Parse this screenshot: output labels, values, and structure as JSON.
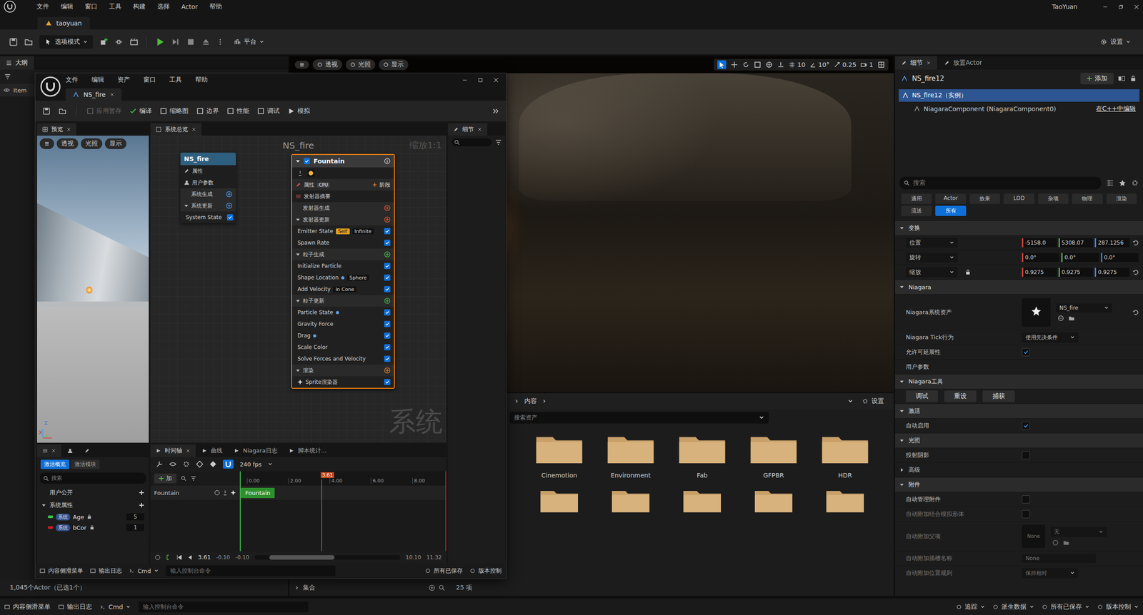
{
  "menubar": {
    "items": [
      "文件",
      "编辑",
      "窗口",
      "工具",
      "构建",
      "选择",
      "Actor",
      "帮助"
    ],
    "user": "TaoYuan"
  },
  "level_tab": {
    "label": "taoyuan"
  },
  "toolbar": {
    "mode": "选项模式",
    "platform": "平台",
    "settings": "设置"
  },
  "outliner": {
    "tab": "大纲",
    "column": "Item",
    "footer": "1,045个Actor（已选1个）"
  },
  "viewport": {
    "view_buttons": [
      "透视",
      "光照",
      "显示"
    ],
    "grid_snap": "10",
    "angle_snap": "10°",
    "scale_snap": "0.25",
    "camera_speed": "1"
  },
  "content_browser": {
    "path": "内容",
    "settings": "设置",
    "search": "搜索资产",
    "folders": [
      "Cinemotion",
      "Environment",
      "Fab",
      "GFPBR",
      "HDR"
    ],
    "collections": "集合",
    "count": "25 项"
  },
  "details": {
    "tabs": [
      {
        "label": "细节",
        "selected": true
      },
      {
        "label": "放置Actor",
        "selected": false
      }
    ],
    "actor": "NS_fire12",
    "add": "添加",
    "tree": [
      {
        "label": "NS_fire12（实例）",
        "selected": true,
        "link": ""
      },
      {
        "label": "NiagaraComponent (NiagaraComponent0)",
        "selected": false,
        "link": "在C++中编辑"
      }
    ],
    "search": "搜索",
    "filters": [
      {
        "label": "通用",
        "selected": false
      },
      {
        "label": "Actor",
        "selected": false
      },
      {
        "label": "效果",
        "selected": false
      },
      {
        "label": "LOD",
        "selected": false
      },
      {
        "label": "杂项",
        "selected": false
      },
      {
        "label": "物理",
        "selected": false
      },
      {
        "label": "渲染",
        "selected": false
      },
      {
        "label": "流送",
        "selected": false
      },
      {
        "label": "所有",
        "selected": true
      }
    ],
    "rows": [
      {
        "kind": "section",
        "label": "变换",
        "expanded": true,
        "disabled": false
      },
      {
        "kind": "vector",
        "label": "位置",
        "values": [
          "-5158.0",
          "5308.07",
          "287.1256"
        ],
        "reset": true,
        "locked": false,
        "disabled": false
      },
      {
        "kind": "vector",
        "label": "旋转",
        "values": [
          "0.0°",
          "0.0°",
          "0.0°"
        ],
        "reset": false,
        "locked": false,
        "disabled": false
      },
      {
        "kind": "vector",
        "label": "缩放",
        "values": [
          "0.9275",
          "0.9275",
          "0.9275"
        ],
        "reset": true,
        "locked": true,
        "disabled": false
      },
      {
        "kind": "section",
        "label": "Niagara",
        "expanded": true,
        "disabled": false
      },
      {
        "kind": "asset",
        "label": "Niagara系统资产",
        "value": "NS_fire",
        "reset": true,
        "disabled": false
      },
      {
        "kind": "dropdown",
        "label": "Niagara Tick行为",
        "value": "使用先决条件",
        "disabled": false
      },
      {
        "kind": "checkbox",
        "label": "允许可延展性",
        "checked": true,
        "disabled": false
      },
      {
        "kind": "label",
        "label": "用户参数",
        "disabled": false
      },
      {
        "kind": "section",
        "label": "Niagara工具",
        "expanded": true,
        "disabled": false
      },
      {
        "kind": "buttons",
        "label": "",
        "buttons": [
          "调试",
          "重设",
          "捕获"
        ],
        "disabled": false
      },
      {
        "kind": "section",
        "label": "激活",
        "expanded": true,
        "disabled": false
      },
      {
        "kind": "checkbox",
        "label": "自动启用",
        "checked": true,
        "disabled": false
      },
      {
        "kind": "section",
        "label": "光照",
        "expanded": true,
        "disabled": false
      },
      {
        "kind": "checkbox",
        "label": "投射阴影",
        "checked": false,
        "disabled": false
      },
      {
        "kind": "subsection",
        "label": "高级",
        "expanded": false,
        "disabled": false
      },
      {
        "kind": "section",
        "label": "附件",
        "expanded": true,
        "disabled": false
      },
      {
        "kind": "checkbox",
        "label": "自动管理附件",
        "checked": false,
        "disabled": false
      },
      {
        "kind": "checkbox",
        "label": "自动附加结合模拟形体",
        "checked": false,
        "disabled": true
      },
      {
        "kind": "parent",
        "label": "自动附加父项",
        "thumb": "None",
        "value": "无",
        "disabled": true
      },
      {
        "kind": "text",
        "label": "自动附加插槽名称",
        "value": "None",
        "disabled": true
      },
      {
        "kind": "dropdown",
        "label": "自动附加位置规则",
        "value": "保持相对",
        "disabled": true
      }
    ]
  },
  "niagara": {
    "menu": [
      "文件",
      "编辑",
      "资产",
      "窗口",
      "工具",
      "帮助"
    ],
    "tab": "NS_fire",
    "toolbar": [
      {
        "label": "应用暂存",
        "disabled": true
      },
      {
        "label": "编译",
        "disabled": false
      },
      {
        "label": "缩略图",
        "disabled": false
      },
      {
        "label": "边界",
        "disabled": false
      },
      {
        "label": "性能",
        "disabled": false
      },
      {
        "label": "调试",
        "disabled": false
      },
      {
        "label": "模拟",
        "disabled": false
      }
    ],
    "preview": {
      "tab": "预览",
      "buttons": [
        "透视",
        "光照",
        "显示"
      ],
      "axes": [
        "Z",
        "X"
      ]
    },
    "overview": {
      "tab": "系统总览",
      "title": "NS_fire",
      "zoom": "缩放1:1",
      "watermark": "系统"
    },
    "system_node": {
      "title": "NS_fire",
      "rows": [
        {
          "kind": "item",
          "label": "属性",
          "expanded": false,
          "enabled": false
        },
        {
          "kind": "item",
          "label": "用户参数",
          "expanded": false,
          "enabled": false
        },
        {
          "kind": "stage",
          "label": "系统生成",
          "expanded": false,
          "enabled": false
        },
        {
          "kind": "stage",
          "label": "系统更新",
          "expanded": true,
          "enabled": false
        },
        {
          "kind": "module",
          "label": "System State",
          "expanded": false,
          "enabled": true
        }
      ]
    },
    "emitter_node": {
      "title": "Fountain",
      "enabled": true,
      "props": "属性",
      "sim": "CPU",
      "stage_button": "阶段",
      "rows": [
        {
          "kind": "summary",
          "label": "发射器摘要",
          "expanded": false,
          "color": "",
          "tags": [],
          "dot": false,
          "enabled": false
        },
        {
          "kind": "stage",
          "label": "发射器生成",
          "expanded": false,
          "color": "#d8502e",
          "tags": [],
          "dot": false,
          "enabled": false
        },
        {
          "kind": "stage",
          "label": "发射器更新",
          "expanded": true,
          "color": "#d8502e",
          "tags": [],
          "dot": false,
          "enabled": false
        },
        {
          "kind": "module",
          "label": "Emitter State",
          "expanded": false,
          "color": "",
          "tags": [
            {
              "text": "Self",
              "highlight": true
            },
            {
              "text": "Infinite",
              "highlight": false
            }
          ],
          "dot": false,
          "enabled": true
        },
        {
          "kind": "module",
          "label": "Spawn Rate",
          "expanded": false,
          "color": "",
          "tags": [],
          "dot": false,
          "enabled": true
        },
        {
          "kind": "stage",
          "label": "粒子生成",
          "expanded": true,
          "color": "#3fae4a",
          "tags": [],
          "dot": false,
          "enabled": false
        },
        {
          "kind": "module",
          "label": "Initialize Particle",
          "expanded": false,
          "color": "",
          "tags": [],
          "dot": false,
          "enabled": true
        },
        {
          "kind": "module",
          "label": "Shape Location",
          "expanded": false,
          "color": "",
          "tags": [
            {
              "text": "Sphere",
              "highlight": false
            }
          ],
          "dot": true,
          "enabled": true
        },
        {
          "kind": "module",
          "label": "Add Velocity",
          "expanded": false,
          "color": "",
          "tags": [
            {
              "text": "In Cone",
              "highlight": false
            }
          ],
          "dot": false,
          "enabled": true
        },
        {
          "kind": "stage",
          "label": "粒子更新",
          "expanded": true,
          "color": "#3fae4a",
          "tags": [],
          "dot": false,
          "enabled": false
        },
        {
          "kind": "module",
          "label": "Particle State",
          "expanded": false,
          "color": "",
          "tags": [],
          "dot": true,
          "enabled": true
        },
        {
          "kind": "module",
          "label": "Gravity Force",
          "expanded": false,
          "color": "",
          "tags": [],
          "dot": false,
          "enabled": true
        },
        {
          "kind": "module",
          "label": "Drag",
          "expanded": false,
          "color": "",
          "tags": [],
          "dot": true,
          "enabled": true
        },
        {
          "kind": "module",
          "label": "Scale Color",
          "expanded": false,
          "color": "",
          "tags": [],
          "dot": false,
          "enabled": true
        },
        {
          "kind": "module",
          "label": "Solve Forces and Velocity",
          "expanded": false,
          "color": "",
          "tags": [],
          "dot": false,
          "enabled": true
        },
        {
          "kind": "stage",
          "label": "渲染",
          "expanded": true,
          "color": "#d8762e",
          "tags": [],
          "dot": false,
          "enabled": false
        },
        {
          "kind": "renderer",
          "label": "Sprite渲染器",
          "expanded": false,
          "color": "",
          "tags": [],
          "dot": false,
          "enabled": true
        }
      ]
    },
    "details_tab": "细节",
    "params": {
      "tabs": [
        {
          "label": "激活概览",
          "selected": true
        },
        {
          "label": "激活模块",
          "selected": false
        }
      ],
      "search": "搜索",
      "groups": [
        {
          "label": "用户公开",
          "expanded": false
        },
        {
          "label": "系统属性",
          "expanded": true
        }
      ],
      "items": [
        {
          "name": "Age",
          "badge": "系统",
          "value": "5",
          "color": "#35c24a"
        },
        {
          "name": "bCor",
          "badge": "系统",
          "value": "1",
          "color": "#c41e2a"
        }
      ]
    },
    "timeline": {
      "tabs": [
        {
          "label": "时间轴",
          "selected": true
        },
        {
          "label": "曲线",
          "selected": false
        },
        {
          "label": "Niagara日志",
          "selected": false
        },
        {
          "label": "脚本统计...",
          "selected": false
        }
      ],
      "fps": "240 fps",
      "add": "加",
      "track": "Fountain",
      "ticks": [
        "0.00",
        "2.00",
        "4.00",
        "6.00",
        "8.00"
      ],
      "playhead": "3.61",
      "current": "3.61",
      "start_in": "-0.10",
      "start_view": "-0.10",
      "end_view": "10.10",
      "end_out": "11.32"
    },
    "bottom_bar": {
      "left": [
        "内容侧滑菜单",
        "输出日志"
      ],
      "cmd": "Cmd",
      "console": "输入控制台命令",
      "right": [
        "所有已保存",
        "版本控制"
      ]
    }
  },
  "status_bar": {
    "left": [
      "内容侧滑菜单",
      "输出日志"
    ],
    "cmd": "Cmd",
    "console": "输入控制台命令",
    "right": [
      "追踪",
      "派生数据",
      "所有已保存",
      "版本控制"
    ]
  }
}
